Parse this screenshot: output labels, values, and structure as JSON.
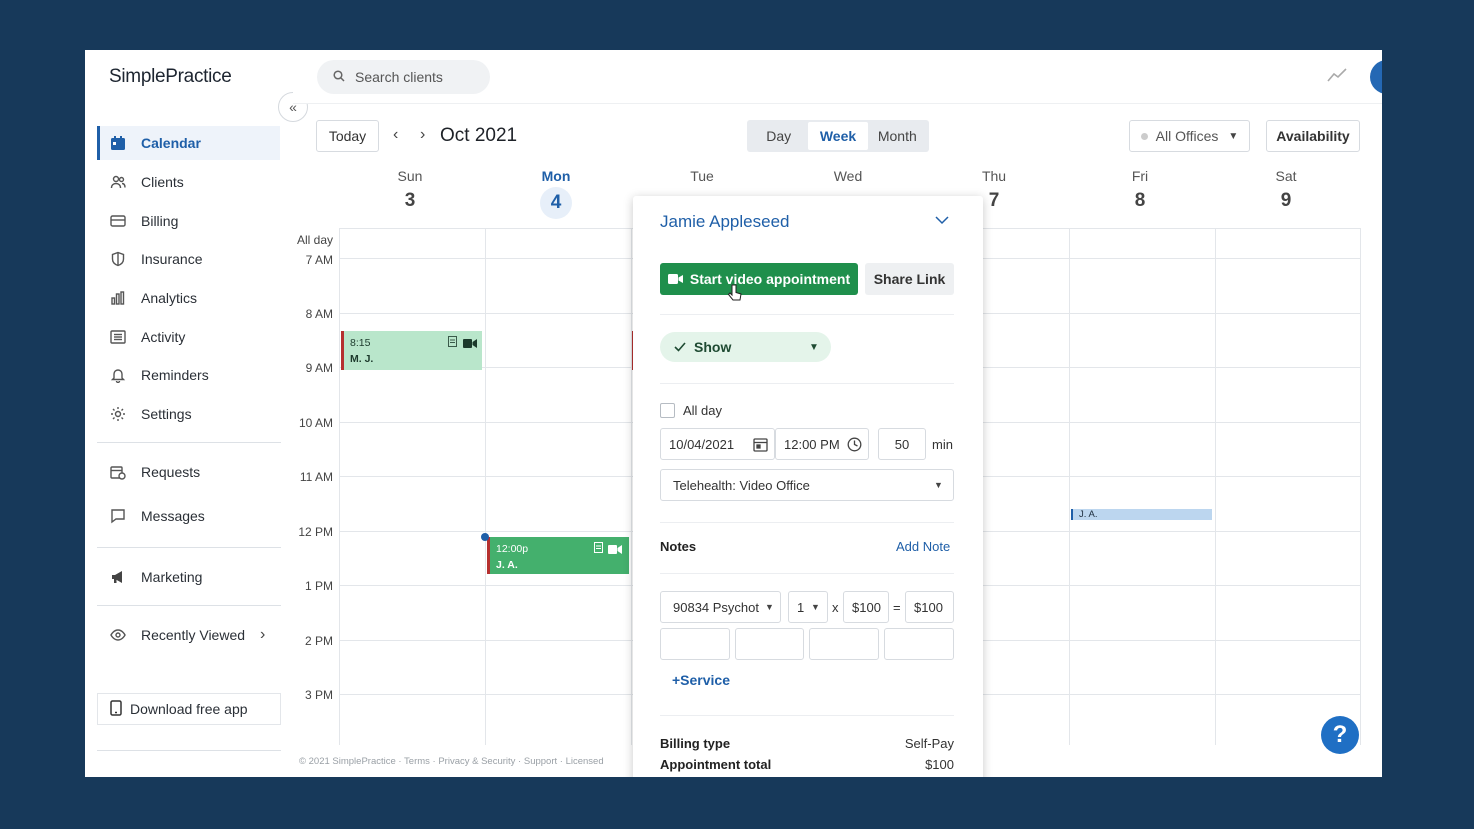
{
  "app": {
    "logo": "SimplePractice"
  },
  "sidebar": {
    "items": [
      {
        "label": "Calendar",
        "icon": "calendar-icon"
      },
      {
        "label": "Clients",
        "icon": "users-icon"
      },
      {
        "label": "Billing",
        "icon": "credit-card-icon"
      },
      {
        "label": "Insurance",
        "icon": "shield-icon"
      },
      {
        "label": "Analytics",
        "icon": "bar-chart-icon"
      },
      {
        "label": "Activity",
        "icon": "list-icon"
      },
      {
        "label": "Reminders",
        "icon": "bell-icon"
      },
      {
        "label": "Settings",
        "icon": "gear-icon"
      },
      {
        "label": "Requests",
        "icon": "calendar-clock-icon"
      },
      {
        "label": "Messages",
        "icon": "message-icon"
      },
      {
        "label": "Marketing",
        "icon": "megaphone-icon"
      },
      {
        "label": "Recently Viewed",
        "icon": "eye-icon"
      }
    ],
    "download_label": "Download free app"
  },
  "topbar": {
    "search_placeholder": "Search clients"
  },
  "toolbar": {
    "today_label": "Today",
    "month_title": "Oct 2021",
    "views": [
      "Day",
      "Week",
      "Month"
    ],
    "active_view": "Week",
    "offices_label": "All Offices",
    "availability_label": "Availability"
  },
  "calendar": {
    "days": [
      {
        "name": "Sun",
        "date": "3"
      },
      {
        "name": "Mon",
        "date": "4"
      },
      {
        "name": "Tue",
        "date": ""
      },
      {
        "name": "Wed",
        "date": ""
      },
      {
        "name": "Thu",
        "date": "7"
      },
      {
        "name": "Fri",
        "date": "8"
      },
      {
        "name": "Sat",
        "date": "9"
      }
    ],
    "all_day_label": "All day",
    "times": [
      "7 AM",
      "8 AM",
      "9 AM",
      "10 AM",
      "11 AM",
      "12 PM",
      "1 PM",
      "2 PM",
      "3 PM"
    ],
    "events": [
      {
        "time": "8:15",
        "initials": "M. J."
      },
      {
        "time": "12:00p",
        "initials": "J. A."
      },
      {
        "time": "",
        "initials": "J. A."
      }
    ],
    "footer": "© 2021 SimplePractice · Terms · Privacy & Security · Support · Licensed"
  },
  "popup": {
    "client_name": "Jamie Appleseed",
    "start_video_label": "Start video appointment",
    "share_link_label": "Share Link",
    "status": "Show",
    "all_day_label": "All day",
    "date": "10/04/2021",
    "time": "12:00 PM",
    "duration": "50",
    "duration_unit": "min",
    "location": "Telehealth: Video Office",
    "notes_label": "Notes",
    "add_note_label": "Add Note",
    "service_code": "90834 Psychot",
    "units": "1",
    "times_sign": "x",
    "rate": "$100",
    "equals_sign": "=",
    "line_total": "$100",
    "add_service_label": "+Service",
    "billing_type_label": "Billing type",
    "billing_type_value": "Self-Pay",
    "appointment_total_label": "Appointment total",
    "appointment_total_value": "$100"
  },
  "colors": {
    "accent": "#1f5fa8",
    "video_green": "#1f8f4c",
    "event_green": "#b9e6cb",
    "background": "#17395a"
  }
}
